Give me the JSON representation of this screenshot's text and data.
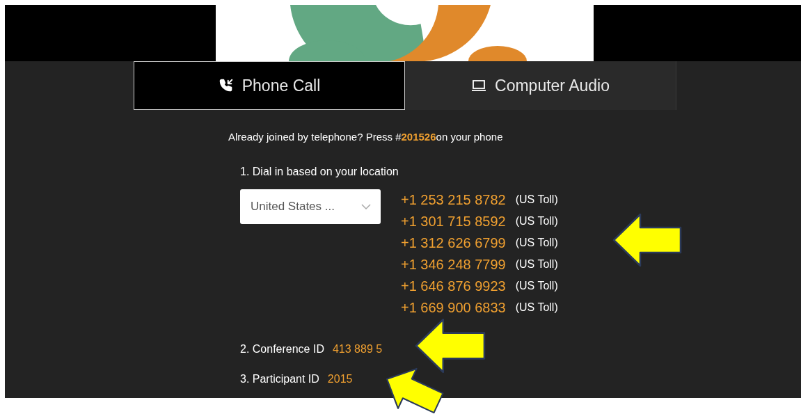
{
  "tabs": [
    {
      "label": "Phone Call",
      "kind": "phone",
      "selected": true
    },
    {
      "label": "Computer Audio",
      "kind": "computer",
      "selected": false
    }
  ],
  "joined_note": {
    "before": "Already joined by telephone? Press #",
    "code": "201526",
    "after": "on your phone"
  },
  "step_1": {
    "label": "1. Dial in based on your location",
    "country": {
      "value": "United States ..."
    },
    "numbers": [
      {
        "number": "+1 253 215 8782",
        "type": "(US Toll)"
      },
      {
        "number": "+1 301 715 8592",
        "type": "(US Toll)"
      },
      {
        "number": "+1 312 626 6799",
        "type": "(US Toll)"
      },
      {
        "number": "+1 346 248 7799",
        "type": "(US Toll)"
      },
      {
        "number": "+1 646 876 9923",
        "type": "(US Toll)"
      },
      {
        "number": "+1 669 900 6833",
        "type": "(US Toll)"
      }
    ]
  },
  "step_2": {
    "label": "2. Conference ID",
    "value": "413 889 5"
  },
  "step_3": {
    "label": "3. Participant ID",
    "value": "2015"
  }
}
